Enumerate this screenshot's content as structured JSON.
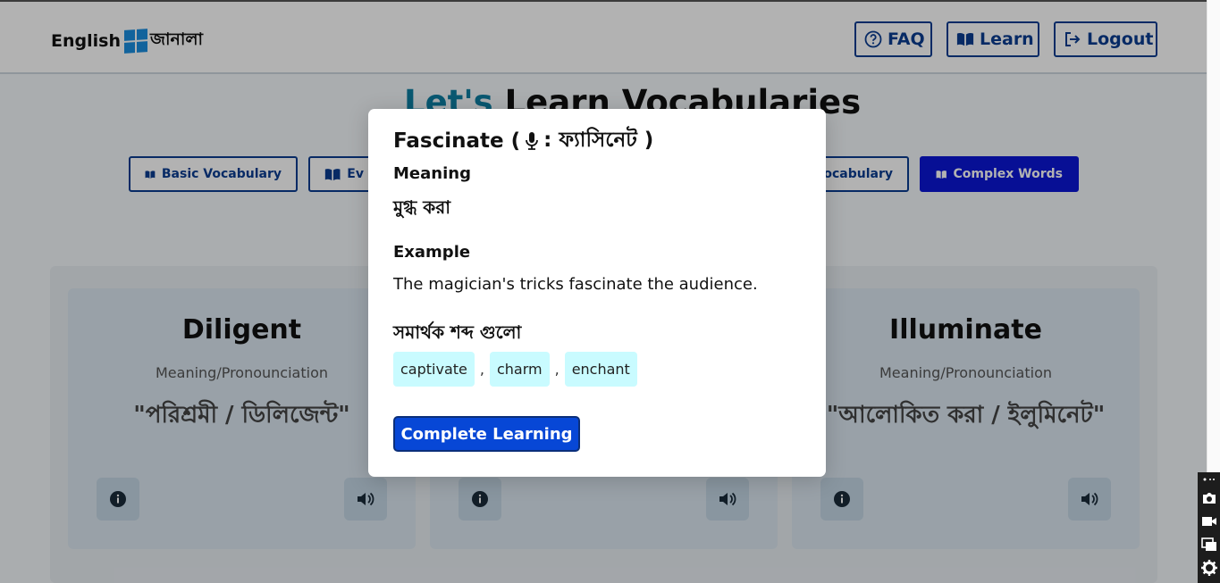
{
  "navbar": {
    "brand_en": "English",
    "brand_bn": "জানালা",
    "faq_label": "FAQ",
    "learn_label": "Learn",
    "logout_label": "Logout"
  },
  "hero": {
    "title_accent": "Let's",
    "title_rest": "Learn Vocabularies"
  },
  "categories": [
    {
      "label": "Basic Vocabulary"
    },
    {
      "label": "Ev"
    },
    {
      "label": "ocabulary"
    },
    {
      "label": "Complex Words",
      "active": true
    }
  ],
  "cards": [
    {
      "word": "Diligent",
      "mp_label": "Meaning/Pronounciation",
      "translation": "\"পরিশ্রমী / ডিলিজেন্ট\""
    },
    {
      "word": "",
      "mp_label": "",
      "translation": ""
    },
    {
      "word": "Illuminate",
      "mp_label": "Meaning/Pronounciation",
      "translation": "\"আলোকিত করা / ইলুমিনেট\""
    }
  ],
  "modal": {
    "title_word": "Fascinate (",
    "title_pron": ": ফ্যাসিনেট )",
    "meaning_label": "Meaning",
    "meaning_value": "মুগ্ধ করা",
    "example_label": "Example",
    "example_value": "The magician's tricks fascinate the audience.",
    "synonyms_label": "সমার্থক শব্দ গুলো",
    "synonyms": [
      "captivate",
      "charm",
      "enchant"
    ],
    "separator": ",",
    "complete_label": "Complete Learning"
  },
  "colors": {
    "accent": "#0d7ea3",
    "primary": "#0747d6",
    "chip": "#c9fbff",
    "nav_border": "#0b3d91"
  },
  "icons": [
    "question-circle-icon",
    "book-open-icon",
    "logout-icon",
    "info-icon",
    "speaker-icon",
    "microphone-icon",
    "camera-icon",
    "video-icon",
    "screens-icon",
    "gear-icon"
  ]
}
